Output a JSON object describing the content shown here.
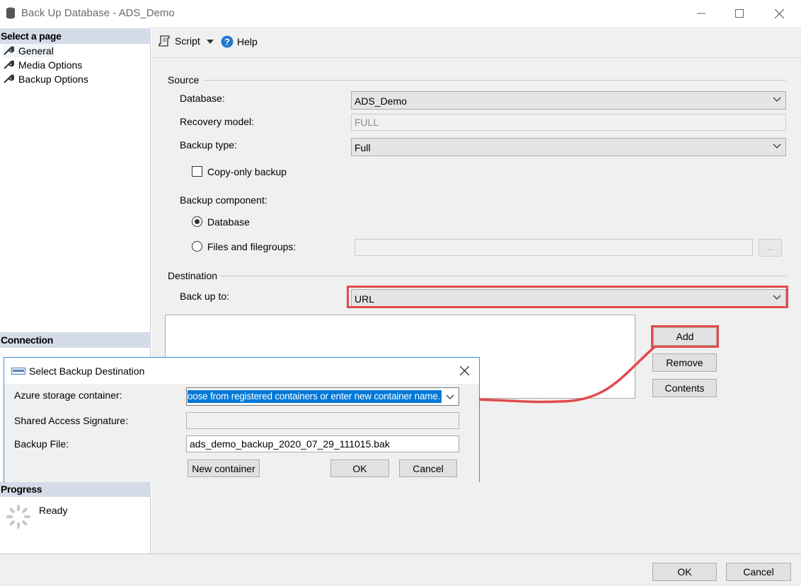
{
  "window": {
    "title": "Back Up Database - ADS_Demo",
    "controls": {
      "minimize": "─",
      "maximize": "☐",
      "close": "✕"
    }
  },
  "left_pane": {
    "select_page_header": "Select a page",
    "pages": [
      {
        "label": "General",
        "icon": "wrench-icon"
      },
      {
        "label": "Media Options",
        "icon": "wrench-icon"
      },
      {
        "label": "Backup Options",
        "icon": "wrench-icon"
      }
    ],
    "connection_header": "Connection",
    "progress_header": "Progress",
    "progress_status": "Ready"
  },
  "toolbar": {
    "script_label": "Script",
    "help_label": "Help"
  },
  "source": {
    "group_label": "Source",
    "database_label": "Database:",
    "database_value": "ADS_Demo",
    "recovery_model_label": "Recovery model:",
    "recovery_model_value": "FULL",
    "backup_type_label": "Backup type:",
    "backup_type_value": "Full",
    "copy_only_label": "Copy-only backup",
    "copy_only_checked": false,
    "backup_component_label": "Backup component:",
    "component_database_label": "Database",
    "component_files_label": "Files and filegroups:",
    "browse_label": "..."
  },
  "destination": {
    "group_label": "Destination",
    "back_up_to_label": "Back up to:",
    "back_up_to_value": "URL",
    "add_label": "Add",
    "remove_label": "Remove",
    "contents_label": "Contents"
  },
  "dialog": {
    "title": "Select Backup Destination",
    "close": "✕",
    "azure_container_label": "Azure storage container:",
    "azure_container_value": "oose from registered containers or enter new container name.",
    "sas_label": "Shared Access Signature:",
    "sas_value": "",
    "backup_file_label": "Backup File:",
    "backup_file_value": "ads_demo_backup_2020_07_29_111015.bak",
    "new_container_label": "New container",
    "ok_label": "OK",
    "cancel_label": "Cancel"
  },
  "footer": {
    "ok_label": "OK",
    "cancel_label": "Cancel"
  },
  "colors": {
    "highlight_red": "#e24b4b",
    "header_band": "#d6dbe9",
    "selection_blue": "#0078d7",
    "help_blue": "#1f78d1"
  }
}
